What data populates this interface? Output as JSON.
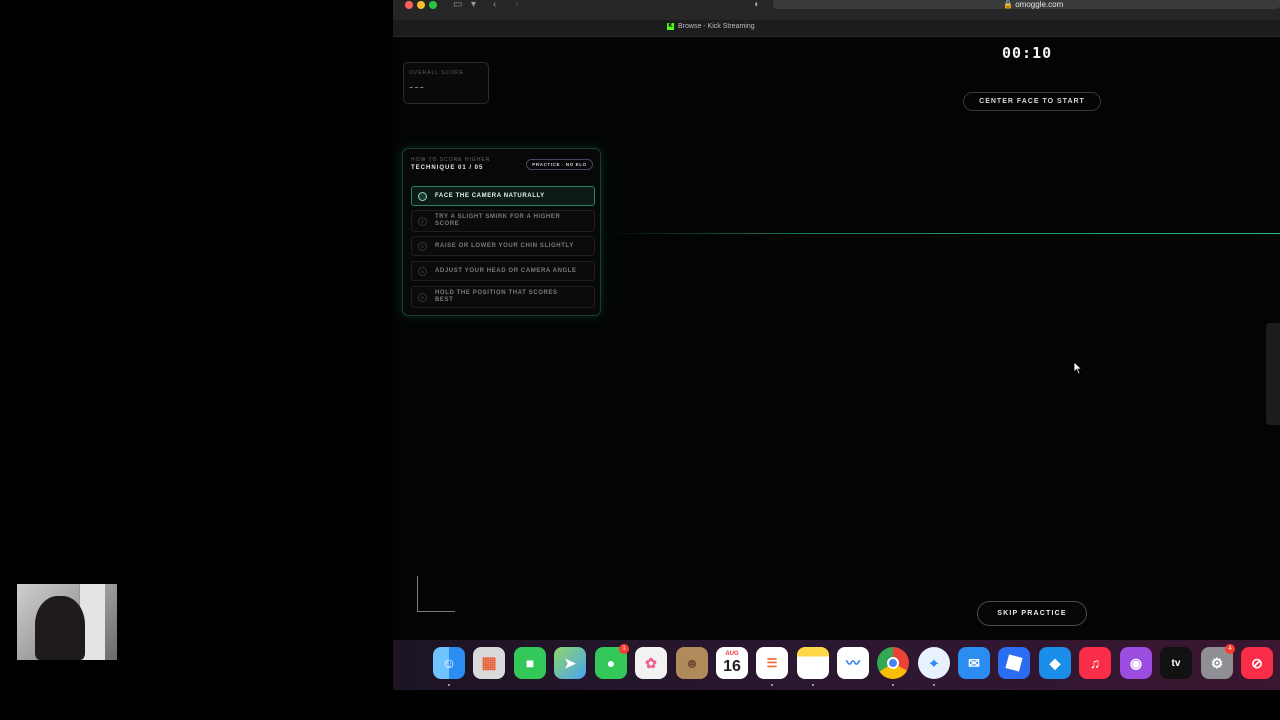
{
  "browser": {
    "url": "omoggle.com",
    "tab_title": "Browse - Kick Streaming"
  },
  "score": {
    "label": "OVERALL SCORE",
    "value": "---"
  },
  "timer": "00:10",
  "center_prompt": "CENTER FACE TO START",
  "technique_panel": {
    "subtitle": "HOW TO SCORE HIGHER",
    "title": "TECHNIQUE 01 / 05",
    "badge": "PRACTICE · NO ELO",
    "steps": [
      {
        "num": "1",
        "label": "FACE THE CAMERA NATURALLY"
      },
      {
        "num": "2",
        "label": "TRY A SLIGHT SMIRK FOR A HIGHER SCORE"
      },
      {
        "num": "3",
        "label": "RAISE OR LOWER YOUR CHIN SLIGHTLY"
      },
      {
        "num": "4",
        "label": "ADJUST YOUR HEAD OR CAMERA ANGLE"
      },
      {
        "num": "5",
        "label": "HOLD THE POSITION THAT SCORES BEST"
      }
    ],
    "active_step": 1
  },
  "skip_button": "SKIP PRACTICE",
  "dock": {
    "calendar_month": "AUG",
    "calendar_day": "16",
    "messages_badge": "1",
    "settings_badge": "4",
    "apps": [
      "finder-icon",
      "launchpad-icon",
      "facetime-icon",
      "maps-icon",
      "messages-icon",
      "photos-icon",
      "contacts-icon",
      "calendar-icon",
      "reminders-icon",
      "notes-icon",
      "freeform-icon",
      "chrome-icon",
      "safari-icon",
      "mail-icon",
      "roblox-icon",
      "roblox-studio-icon",
      "music-icon",
      "podcasts-icon",
      "appletv-icon",
      "system-settings-icon",
      "news-icon"
    ],
    "tv_label": "tv"
  },
  "colors": {
    "accent": "#2fd6a6",
    "panel_border": "#1f3b33",
    "badge_border": "#4a4560"
  }
}
